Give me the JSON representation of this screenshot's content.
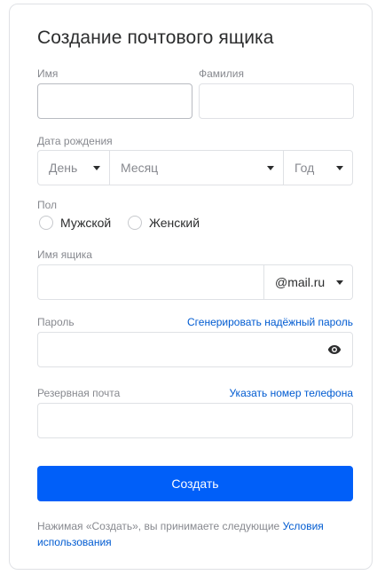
{
  "form": {
    "title": "Создание почтового ящика",
    "first_name": {
      "label": "Имя",
      "value": ""
    },
    "last_name": {
      "label": "Фамилия",
      "value": ""
    },
    "birth_date": {
      "label": "Дата рождения",
      "day": "День",
      "month": "Месяц",
      "year": "Год"
    },
    "gender": {
      "label": "Пол",
      "options": [
        "Мужской",
        "Женский"
      ]
    },
    "mailbox": {
      "label": "Имя ящика",
      "value": "",
      "domain": "@mail.ru"
    },
    "password": {
      "label": "Пароль",
      "generate_link": "Сгенерировать надёжный пароль",
      "value": ""
    },
    "backup_email": {
      "label": "Резервная почта",
      "phone_link": "Указать номер телефона",
      "value": ""
    },
    "submit_label": "Создать",
    "terms_text": "Нажимая «Создать», вы принимаете следующие ",
    "terms_link": "Условия использования"
  },
  "colors": {
    "accent": "#005ff9",
    "link": "#005bd1",
    "border": "#dfe1e5",
    "muted_text": "#87898f"
  },
  "icons": {
    "password_toggle": "eye-icon",
    "dropdown": "caret-down-icon"
  }
}
